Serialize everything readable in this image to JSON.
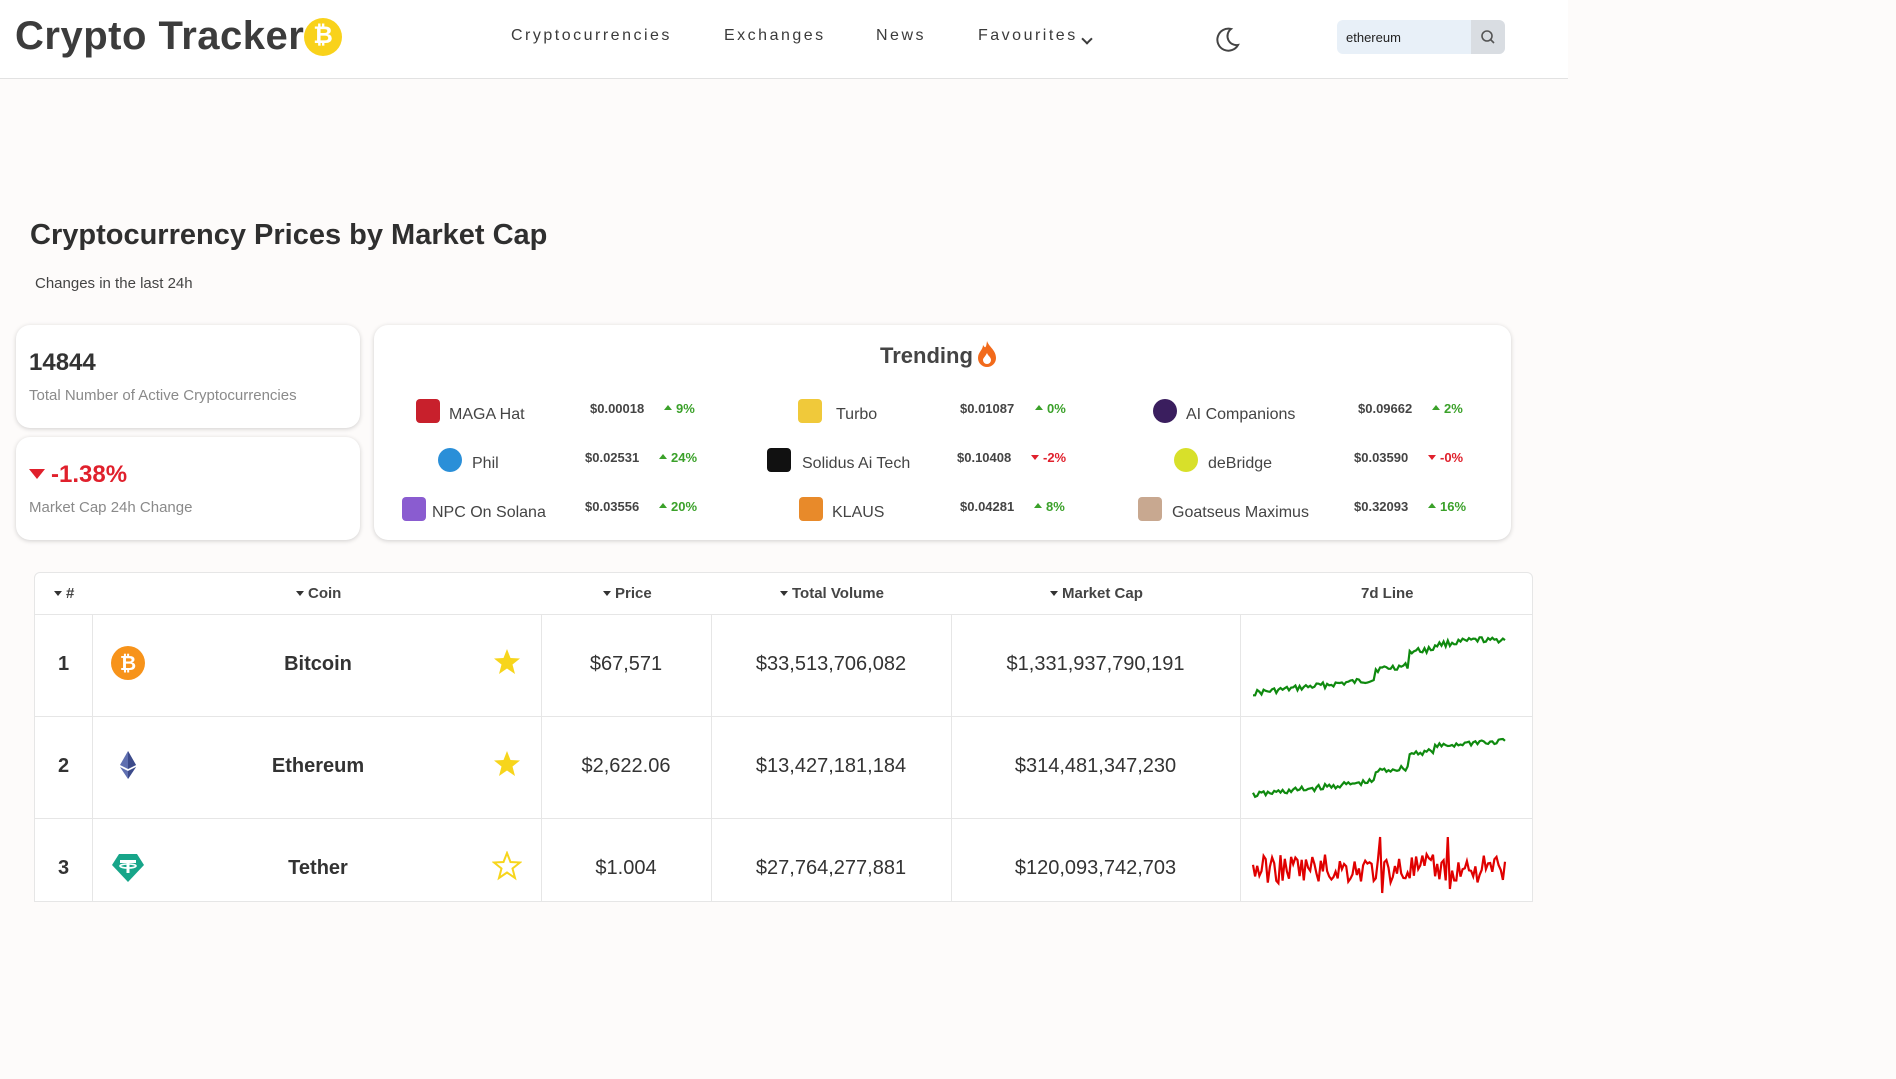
{
  "header": {
    "logo": "Crypto Tracker",
    "logo_coin_symbol": "₿",
    "nav": [
      "Cryptocurrencies",
      "Exchanges",
      "News",
      "Favourites"
    ],
    "search_value": "ethereum"
  },
  "page": {
    "title": "Cryptocurrency Prices by Market Cap",
    "subtitle": "Changes in the last 24h"
  },
  "stats": {
    "active_count": "14844",
    "active_label": "Total Number of Active Cryptocurrencies",
    "mcap_change": "-1.38%",
    "mcap_label": "Market Cap 24h Change"
  },
  "trending": {
    "title": "Trending",
    "items": [
      {
        "name": "MAGA Hat",
        "price": "$0.00018",
        "change": "9%",
        "dir": "up",
        "icon": "maga-hat-icon",
        "color": "#c8202c"
      },
      {
        "name": "Turbo",
        "price": "$0.01087",
        "change": "0%",
        "dir": "up",
        "icon": "turbo-icon",
        "color": "#f0c93a"
      },
      {
        "name": "AI Companions",
        "price": "$0.09662",
        "change": "2%",
        "dir": "up",
        "icon": "ai-companions-icon",
        "color": "#3a1e5e"
      },
      {
        "name": "Phil",
        "price": "$0.02531",
        "change": "24%",
        "dir": "up",
        "icon": "phil-icon",
        "color": "#2a8fd8"
      },
      {
        "name": "Solidus Ai Tech",
        "price": "$0.10408",
        "change": "-2%",
        "dir": "down",
        "icon": "solidus-ai-tech-icon",
        "color": "#111111"
      },
      {
        "name": "deBridge",
        "price": "$0.03590",
        "change": "-0%",
        "dir": "down",
        "icon": "debridge-icon",
        "color": "#d8e02a"
      },
      {
        "name": "NPC On Solana",
        "price": "$0.03556",
        "change": "20%",
        "dir": "up",
        "icon": "npc-on-solana-icon",
        "color": "#8a5cd0"
      },
      {
        "name": "KLAUS",
        "price": "$0.04281",
        "change": "8%",
        "dir": "up",
        "icon": "klaus-icon",
        "color": "#e88a2a"
      },
      {
        "name": "Goatseus Maximus",
        "price": "$0.32093",
        "change": "16%",
        "dir": "up",
        "icon": "goatseus-maximus-icon",
        "color": "#c8a890"
      }
    ]
  },
  "table": {
    "headers": [
      "#",
      "Coin",
      "Price",
      "Total Volume",
      "Market Cap",
      "7d Line"
    ],
    "rows": [
      {
        "rank": "1",
        "coin": "Bitcoin",
        "price": "$67,571",
        "volume": "$33,513,706,082",
        "mcap": "$1,331,937,790,191",
        "favourite": true,
        "icon": "bitcoin-icon",
        "trend_color": "#0f8a0f"
      },
      {
        "rank": "2",
        "coin": "Ethereum",
        "price": "$2,622.06",
        "volume": "$13,427,181,184",
        "mcap": "$314,481,347,230",
        "favourite": true,
        "icon": "ethereum-icon",
        "trend_color": "#0f8a0f"
      },
      {
        "rank": "3",
        "coin": "Tether",
        "price": "$1.004",
        "volume": "$27,764,277,881",
        "mcap": "$120,093,742,703",
        "favourite": false,
        "icon": "tether-icon",
        "trend_color": "#e00000"
      }
    ]
  },
  "colors": {
    "accent_yellow": "#f9d21b",
    "up": "#3ba12a",
    "down": "#e0202c",
    "star": "#f7d51c"
  }
}
